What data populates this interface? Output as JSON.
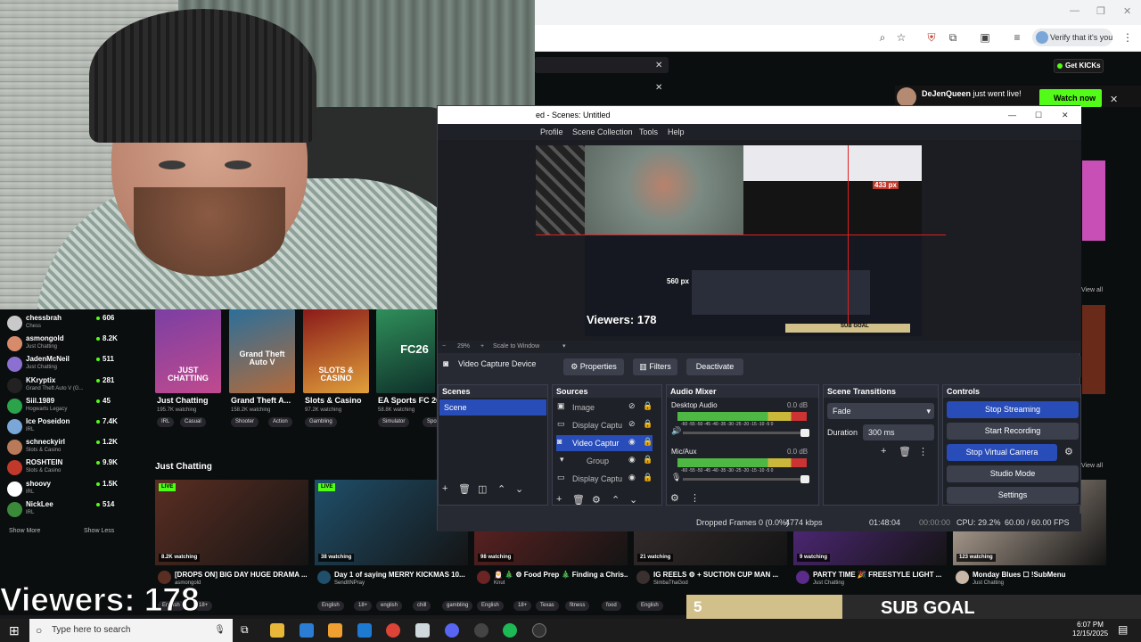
{
  "browser": {
    "verify_chip": "Verify that it's you",
    "get_kicks": "Get KICKs",
    "toast_name": "DeJenQueen",
    "toast_text": "just went live!",
    "watch_now": "Watch now",
    "view_all_1": "View all",
    "view_all_2": "View all"
  },
  "sidebar": {
    "channels": [
      {
        "name": "chessbrah",
        "category": "Chess",
        "viewers": "606",
        "color": "#c9c9c9"
      },
      {
        "name": "asmongold",
        "category": "Just Chatting",
        "viewers": "8.2K",
        "color": "#d88b6a"
      },
      {
        "name": "JadenMcNeil",
        "category": "Just Chatting",
        "viewers": "511",
        "color": "#8b6fd1"
      },
      {
        "name": "KKryptix",
        "category": "Grand Theft Auto V (G...",
        "viewers": "281",
        "color": "#222"
      },
      {
        "name": "Siil.1989",
        "category": "Hogwarts Legacy",
        "viewers": "45",
        "color": "#2aa34a"
      },
      {
        "name": "Ice Poseidon",
        "category": "IRL",
        "viewers": "7.4K",
        "color": "#7aa7d8"
      },
      {
        "name": "schneckyirl",
        "category": "Slots & Casino",
        "viewers": "1.2K",
        "color": "#b97a5a"
      },
      {
        "name": "ROSHTEIN",
        "category": "Slots & Casino",
        "viewers": "9.9K",
        "color": "#c0392b"
      },
      {
        "name": "shoovy",
        "category": "IRL",
        "viewers": "1.5K",
        "color": "#fff"
      },
      {
        "name": "NickLee",
        "category": "IRL",
        "viewers": "514",
        "color": "#3a8a3a"
      }
    ],
    "show_more": "Show More",
    "show_less": "Show Less"
  },
  "categories": [
    {
      "title": "Just Chatting",
      "count": "195.7K watching",
      "tags": [
        "IRL",
        "Casual"
      ],
      "card_text": "JUST CHATTING"
    },
    {
      "title": "Grand Theft A...",
      "count": "158.2K watching",
      "tags": [
        "Shooter",
        "Action"
      ],
      "card_text": "Grand Theft Auto V"
    },
    {
      "title": "Slots & Casino",
      "count": "97.2K watching",
      "tags": [
        "Gambling"
      ],
      "card_text": "SLOTS & CASINO"
    },
    {
      "title": "EA Sports FC 26",
      "count": "58.8K watching",
      "tags": [
        "Simulator",
        "Sport"
      ],
      "card_text": "FC26"
    }
  ],
  "section_title": "Just Chatting",
  "streams": [
    {
      "title": "[DROPS ON] BIG DAY HUGE DRAMA ...",
      "user": "asmongold",
      "watching": "8.2K watching",
      "live": "LIVE",
      "tags": [
        "English",
        "18+"
      ]
    },
    {
      "title": "Day 1 of saying MERRY KICKMAS 10...",
      "user": "SendItNPray",
      "watching": "38 watching",
      "live": "LIVE",
      "tags": [
        "English",
        "18+",
        "english",
        "chill",
        "gambling"
      ]
    },
    {
      "title": "🎅 🎄 ⚙ Food Prep 🎄 Finding a Chris...",
      "user": "Knut",
      "watching": "98 watching",
      "live": "",
      "tags": [
        "English",
        "18+",
        "Texas",
        "fitness",
        "food"
      ]
    },
    {
      "title": "IG REELS ⚙ + SUCTION CUP MAN ...",
      "user": "SimbaThaGod",
      "watching": "21 watching",
      "live": "",
      "tags": [
        "English"
      ]
    },
    {
      "title": "PARTY TIME 🎉 FREESTYLE LIGHT ...",
      "user": "Just Chatting",
      "watching": "9 watching",
      "live": "",
      "tags": [
        "Français"
      ]
    },
    {
      "title": "Monday Blues ☐ !SubMenu",
      "user": "Just Chatting",
      "watching": "123 watching",
      "live": "",
      "tags": [
        "English",
        "18+",
        "chatting",
        "fun"
      ]
    }
  ],
  "obs": {
    "window_title": "ed - Scenes: Untitled",
    "menu": [
      "Profile",
      "Scene Collection",
      "Tools",
      "Help"
    ],
    "zoom": "29%",
    "zoom_mode": "Scale to Window",
    "preview_px_1": "433 px",
    "preview_px_2": "560 px",
    "preview_viewers": "Viewers: 178",
    "preview_subgoal": "SUB GOAL",
    "source_name": "Video Capture Device",
    "properties": "Properties",
    "filters": "Filters",
    "deactivate": "Deactivate",
    "docks": {
      "scenes": "Scenes",
      "sources": "Sources",
      "mixer": "Audio Mixer",
      "transitions": "Scene Transitions",
      "controls": "Controls"
    },
    "scene_list": [
      "Scene"
    ],
    "sources_list": [
      "Image",
      "Display Captu",
      "Video Captur",
      "Group",
      "Display Captu"
    ],
    "mixer": [
      {
        "name": "Desktop Audio",
        "db": "0.0 dB",
        "scale": "-60 -55 -50 -45 -40 -35 -30 -25 -20 -15 -10 -5 0"
      },
      {
        "name": "Mic/Aux",
        "db": "0.0 dB",
        "scale": "-60 -55 -50 -45 -40 -35 -30 -25 -20 -15 -10 -5 0"
      }
    ],
    "transition": "Fade",
    "duration_label": "Duration",
    "duration_value": "300 ms",
    "controls": [
      "Stop Streaming",
      "Start Recording",
      "Stop Virtual Camera",
      "Studio Mode",
      "Settings"
    ],
    "status": {
      "dropped": "Dropped Frames 0 (0.0%)",
      "kbps": "4774 kbps",
      "stream_time": "01:48:04",
      "rec_time": "00:00:00",
      "cpu": "CPU: 29.2%",
      "fps": "60.00 / 60.00 FPS"
    }
  },
  "overlay": {
    "viewers": "Viewers: 178",
    "sub_goal_count": "5",
    "sub_goal": "SUB GOAL"
  },
  "taskbar": {
    "search_placeholder": "Type here to search",
    "time": "6:07 PM",
    "date": "12/15/2025"
  }
}
